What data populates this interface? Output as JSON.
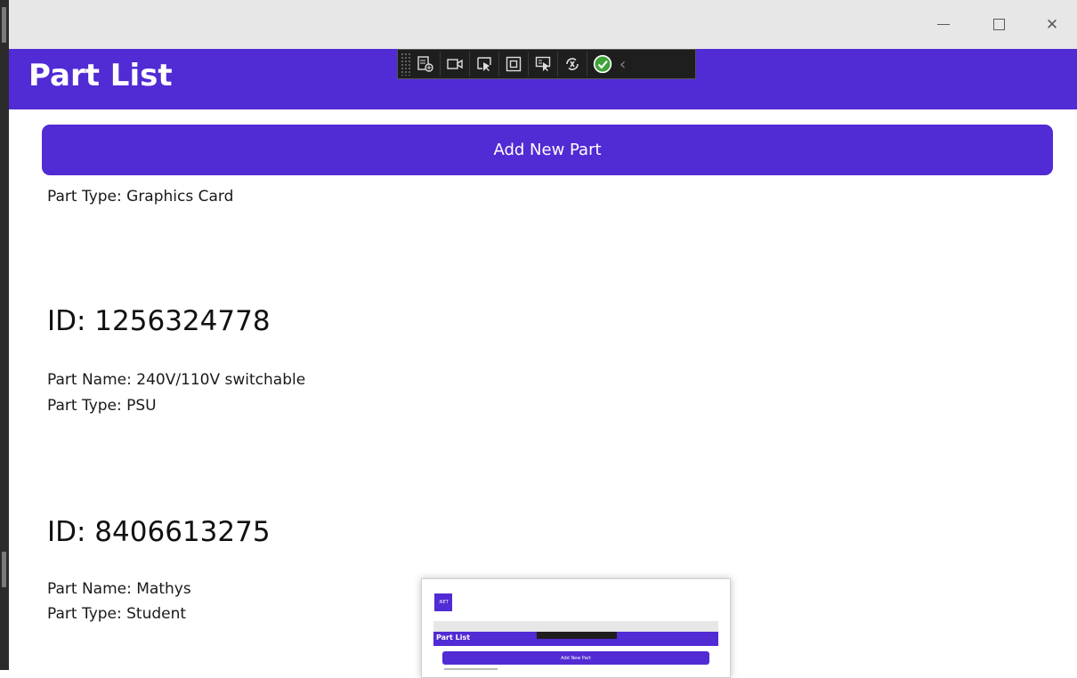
{
  "window": {
    "minimize_label": "—",
    "maximize_label": "□",
    "close_label": "✕"
  },
  "header": {
    "title": "Part List",
    "background_color": "#512bd4"
  },
  "debug_toolbar": {
    "icons": [
      "live-visual-tree-icon",
      "video-camera-icon",
      "select-element-icon",
      "display-layout-adorners-icon",
      "track-focused-element-icon",
      "hot-reload-icon",
      "binding-failures-check-icon",
      "collapse-chevron-icon"
    ]
  },
  "main": {
    "add_button_label": "Add New Part",
    "partial_item": {
      "part_type": "Part Type: Graphics Card"
    },
    "items": [
      {
        "id": "ID: 1256324778",
        "part_name": "Part Name: 240V/110V switchable",
        "part_type": "Part Type: PSU"
      },
      {
        "id": "ID: 8406613275",
        "part_name": "Part Name: Mathys",
        "part_type": "Part Type: Student"
      }
    ]
  },
  "thumbnail": {
    "app_icon_label": ".NET",
    "title": "Part List",
    "add_button_label": "Add New Part"
  }
}
